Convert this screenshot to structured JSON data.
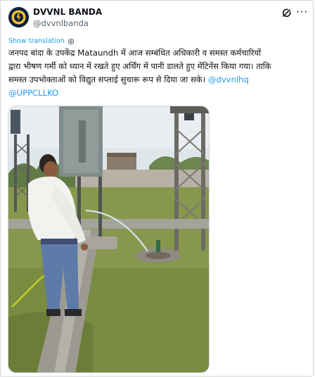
{
  "account": {
    "display_name": "DVVNL BANDA",
    "handle": "@dvvnlbanda",
    "avatar_icon": "dvvnl-logo-icon"
  },
  "actions": {
    "grok_icon": "grok-icon",
    "more_label": "···"
  },
  "translation": {
    "label": "Show translation",
    "icon": "settings-icon"
  },
  "tweet": {
    "line1": "जनपद बांदा के उपकेंद्र Mataundh में आज सम्बंधित अधिकारी व समस्त कर्मचारियों",
    "line2": "द्वारा भीषण गर्मी को ध्यान में रखते हुए अर्थिंग में पानी डालते हुए मेंटिनेंस किया गया। ताकि",
    "line3_text": "समस्त उपभोक्ताओं को विद्युत सप्लाई सुचारू रूप से दिया जा सके। ",
    "mention1": "@dvvnlhq",
    "mention2": "@UPPCLLKO"
  },
  "media": {
    "type": "photo",
    "subject": "worker watering earthing pit at substation"
  },
  "colors": {
    "link": "#1d9bf0",
    "text": "#0f1419",
    "secondary": "#536471",
    "border": "#cfd9de"
  }
}
